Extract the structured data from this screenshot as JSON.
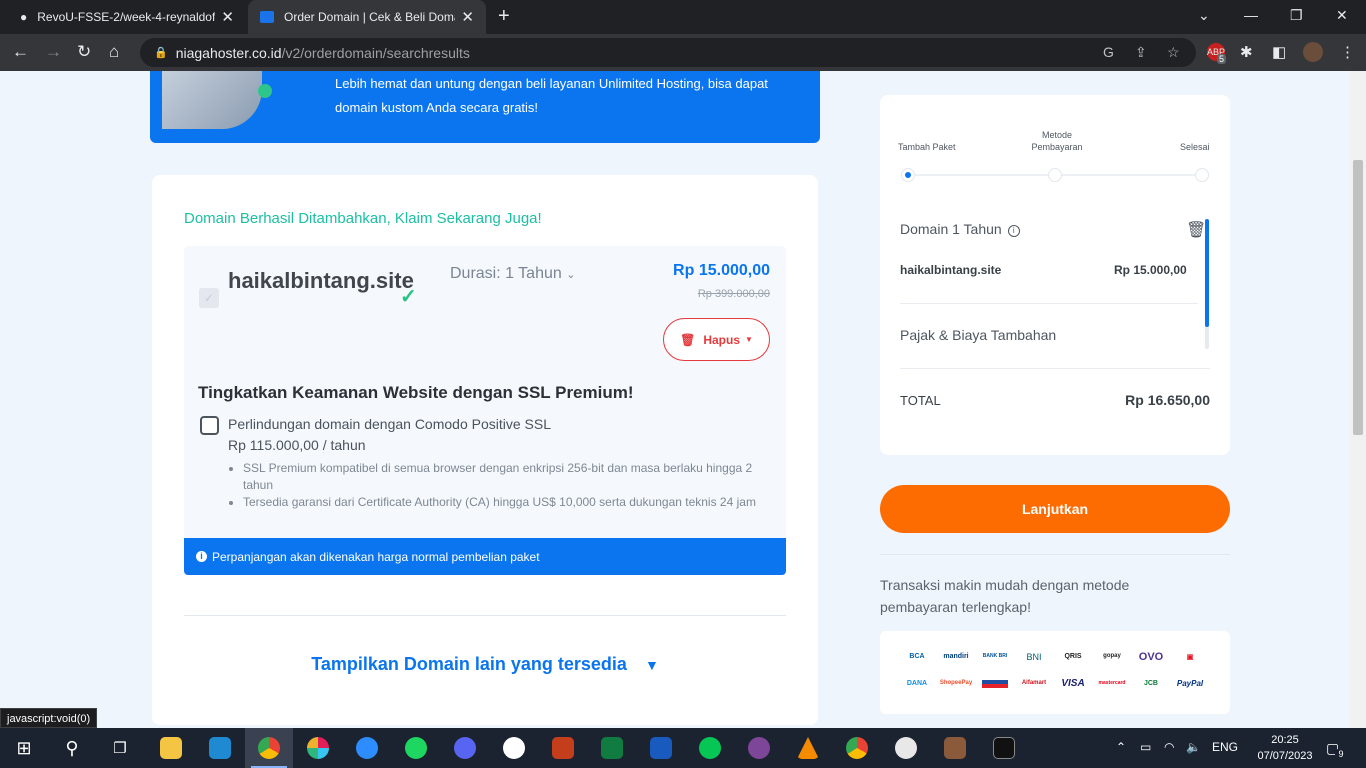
{
  "browser": {
    "tabs": [
      {
        "title": "RevoU-FSSE-2/week-4-reynaldof",
        "icon": "github-icon"
      },
      {
        "title": "Order Domain | Cek & Beli Doma",
        "icon": "niagahoster-icon"
      }
    ],
    "url_host": "niagahoster.co.id",
    "url_path": "/v2/orderdomain/searchresults",
    "ext_badge": "5",
    "status_text": "javascript:void(0)"
  },
  "banner": {
    "text": "Lebih hemat dan untung dengan beli layanan Unlimited Hosting, bisa dapat domain kustom Anda secara gratis!"
  },
  "main": {
    "success_msg": "Domain Berhasil Ditambahkan, Klaim Sekarang Juga!",
    "domain_name": "haikalbintang.site",
    "duration": "Durasi: 1 Tahun",
    "price_now": "Rp 15.000,00",
    "price_old": "Rp 399.000,00",
    "delete_label": "Hapus",
    "ssl_title": "Tingkatkan Keamanan Website dengan SSL Premium!",
    "ssl_option": "Perlindungan domain dengan Comodo Positive SSL",
    "ssl_price": "Rp 115.000,00 / tahun",
    "ssl_features": [
      "SSL Premium kompatibel di semua browser dengan enkripsi 256-bit dan masa berlaku hingga 2 tahun",
      "Tersedia garansi dari Certificate Authority (CA) hingga US$ 10,000 serta dukungan teknis 24 jam"
    ],
    "notice": "Perpanjangan akan dikenakan harga normal pembelian paket",
    "show_more": "Tampilkan Domain lain yang tersedia"
  },
  "summary": {
    "steps": [
      "Tambah Paket",
      "Metode Pembayaran",
      "Selesai"
    ],
    "active_step": 1,
    "domain_label": "Domain 1 Tahun",
    "domain_name": "haikalbintang.site",
    "domain_price": "Rp 15.000,00",
    "tax_label": "Pajak & Biaya Tambahan",
    "total_label": "TOTAL",
    "total_value": "Rp 16.650,00",
    "continue_label": "Lanjutkan",
    "promo_text": "Transaksi makin mudah dengan metode pembayaran terlengkap!",
    "payment_methods": [
      "BCA",
      "mandiri",
      "BANK BRI",
      "BNI",
      "QRIS",
      "gopay",
      "OVO",
      "",
      "DANA",
      "ShopeePay",
      "",
      "Alfamart",
      "VISA",
      "mastercard",
      "JCB",
      "PayPal"
    ]
  },
  "taskbar": {
    "apps": [
      "start-icon",
      "search-icon",
      "task-view-icon",
      "file-explorer-icon",
      "vscode-icon",
      "chrome-icon",
      "slack-icon",
      "zoom-icon",
      "spotify-icon",
      "discord-icon",
      "whatsapp-icon",
      "powerpoint-icon",
      "excel-icon",
      "word-icon",
      "line-icon",
      "tor-icon",
      "vlc-icon",
      "chrome-icon",
      "app-icon",
      "game-icon",
      "terminal-icon"
    ],
    "lang": "ENG",
    "time": "20:25",
    "date": "07/07/2023",
    "notif_count": "9"
  },
  "colors": {
    "brand_blue": "#0b75f0",
    "accent_orange": "#fd6c00",
    "success_green": "#1cbfa3",
    "danger_red": "#e5393c"
  }
}
